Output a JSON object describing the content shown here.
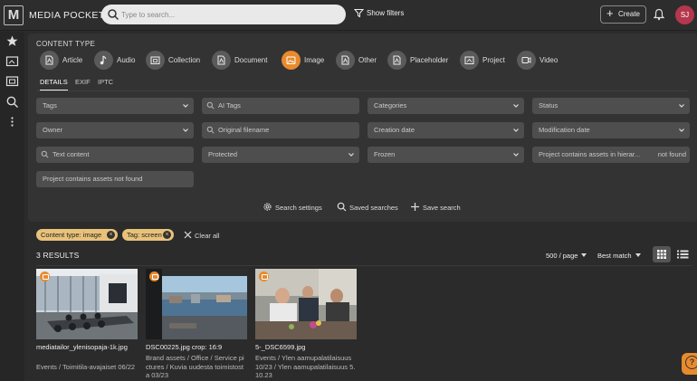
{
  "app": {
    "title": "MEDIA POCKET",
    "logo_letter": "M"
  },
  "search": {
    "placeholder": "Type to search..."
  },
  "header": {
    "show_filters": "Show filters",
    "create_label": "Create",
    "avatar_initials": "SJ"
  },
  "content_type": {
    "label": "CONTENT TYPE",
    "items": [
      {
        "label": "Article",
        "icon": "article-icon"
      },
      {
        "label": "Audio",
        "icon": "audio-icon"
      },
      {
        "label": "Collection",
        "icon": "collection-icon"
      },
      {
        "label": "Document",
        "icon": "document-icon"
      },
      {
        "label": "Image",
        "icon": "image-icon",
        "active": true
      },
      {
        "label": "Other",
        "icon": "other-icon"
      },
      {
        "label": "Placeholder",
        "icon": "placeholder-icon"
      },
      {
        "label": "Project",
        "icon": "project-icon"
      },
      {
        "label": "Video",
        "icon": "video-icon"
      }
    ]
  },
  "tabs": [
    "DETAILS",
    "EXIF",
    "IPTC"
  ],
  "filters": {
    "tags": "Tags",
    "ai_tags": "AI Tags",
    "categories": "Categories",
    "status": "Status",
    "owner": "Owner",
    "original_filename": "Original filename",
    "creation_date": "Creation date",
    "modification_date": "Modification date",
    "text_content": "Text content",
    "protected": "Protected",
    "frozen": "Frozen",
    "project_contains_hier": "Project contains assets in hierar...",
    "project_contains_hier_value": "not found",
    "project_not_found": "Project contains assets not found"
  },
  "actions": {
    "search_settings": "Search settings",
    "saved_searches": "Saved searches",
    "save_search": "Save search"
  },
  "chips": [
    "Content type: image",
    "Tag: screen"
  ],
  "clear_all": "Clear all",
  "results": {
    "count_label": "3 RESULTS",
    "per_page": "500 / page",
    "sort": "Best match",
    "items": [
      {
        "name": "mediatailor_ylenisopaja-1k.jpg",
        "path": "Events / Toimitila-avajaiset 06/22"
      },
      {
        "name": "DSC00225.jpg crop: 16:9",
        "path": "Brand assets / Office / Service pictures / Kuvia uudesta toimistosta 03/23"
      },
      {
        "name": "5-_DSC6599.jpg",
        "path": "Events / Ylen aamupalatilaisuus 10/23 / Ylen aamupalatilaisuus 5.10.23"
      }
    ]
  },
  "colors": {
    "accent": "#e88a2e",
    "chip": "#e9c27a",
    "avatar": "#b5374e",
    "background": "#2b2b2b"
  }
}
